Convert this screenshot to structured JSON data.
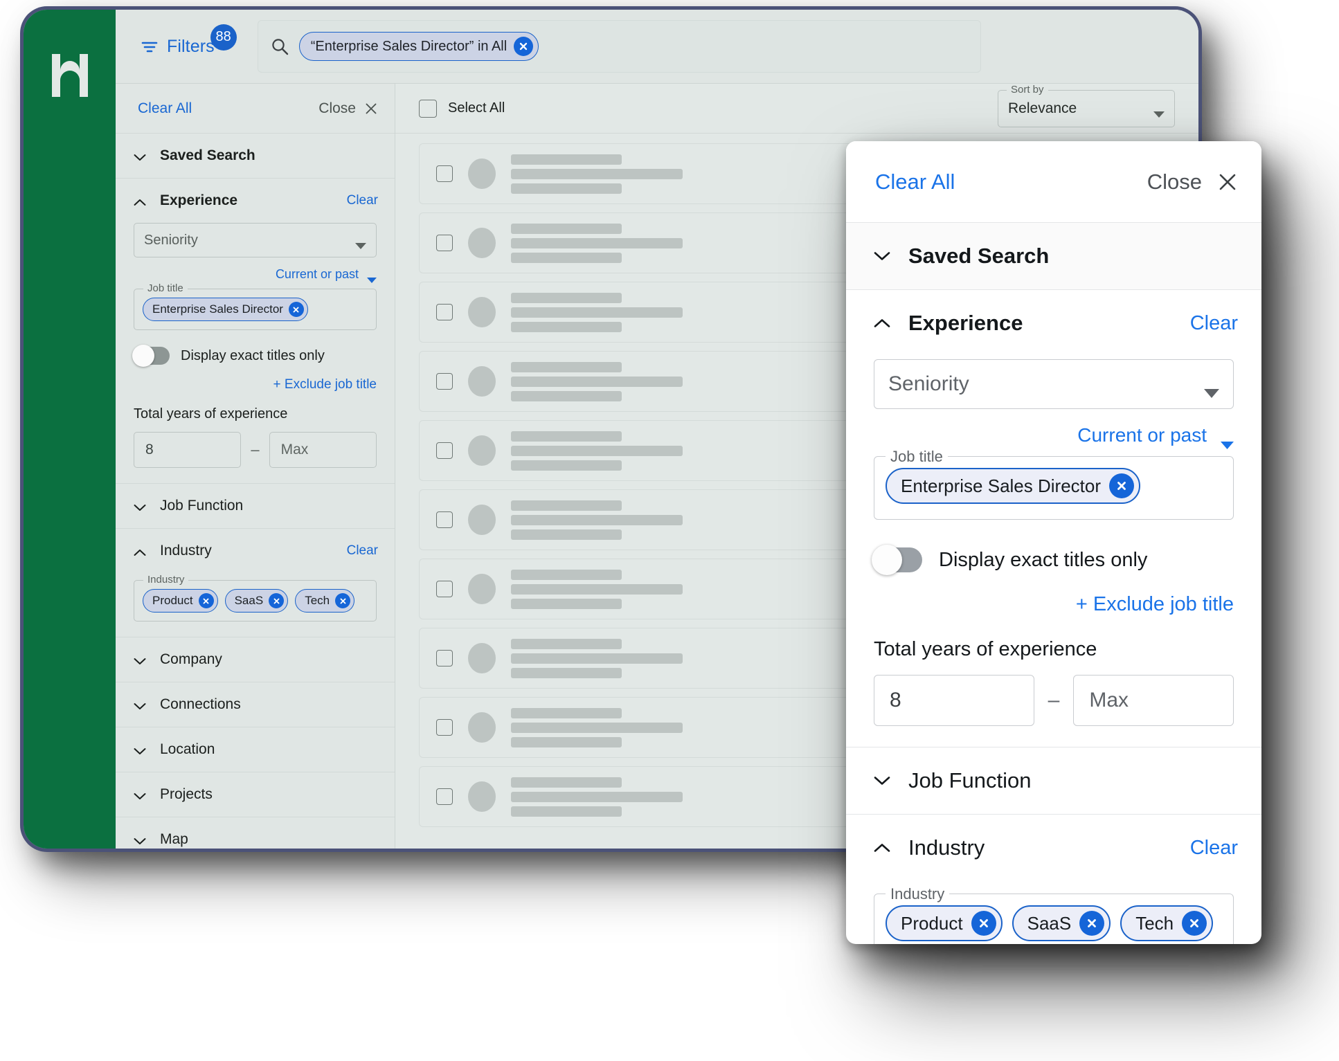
{
  "brand": {
    "logo_letter": "H",
    "logo_color": "#0b7040"
  },
  "accent": {
    "blue": "#1a73e8",
    "chip_blue": "#1565d8",
    "badge_blue": "#1a62c9"
  },
  "topbar": {
    "filters_label": "Filters",
    "filters_badge": "88",
    "filter_icon": "filter-lines-icon",
    "search_icon": "search-icon",
    "search_chip": "“Enterprise Sales Director” in All",
    "search_chip_remove_icon": "close-circle-icon"
  },
  "sidebar": {
    "clear_all": "Clear All",
    "close": "Close",
    "close_icon": "close-icon",
    "sections": [
      {
        "title": "Saved Search",
        "expanded": false,
        "clear": null
      },
      {
        "title": "Experience",
        "expanded": true,
        "clear": "Clear"
      },
      {
        "title": "Job Function",
        "expanded": false,
        "clear": null
      },
      {
        "title": "Industry",
        "expanded": true,
        "clear": "Clear"
      },
      {
        "title": "Company",
        "expanded": false,
        "clear": null
      },
      {
        "title": "Connections",
        "expanded": false,
        "clear": null
      },
      {
        "title": "Location",
        "expanded": false,
        "clear": null
      },
      {
        "title": "Projects",
        "expanded": false,
        "clear": null
      },
      {
        "title": "Map",
        "expanded": false,
        "clear": null
      }
    ],
    "experience": {
      "seniority_placeholder": "Seniority",
      "current_or_past": "Current or past",
      "job_title_legend": "Job title",
      "job_title_tags": [
        "Enterprise Sales Director"
      ],
      "exact_titles_toggle": "Display exact titles only",
      "exact_titles_on": false,
      "exclude_job_title": "+ Exclude job title",
      "years_label": "Total years of experience",
      "years_min": "8",
      "years_max_placeholder": "Max",
      "range_dash": "–"
    },
    "industry": {
      "legend": "Industry",
      "tags": [
        "Product",
        "SaaS",
        "Tech"
      ]
    }
  },
  "results": {
    "select_all": "Select All",
    "sort_legend": "Sort by",
    "sort_value": "Relevance",
    "rows": [
      {
        "line1": 160,
        "line2": 248,
        "line3": 160
      },
      {
        "line1": 160,
        "line2": 248,
        "line3": 160
      },
      {
        "line1": 160,
        "line2": 248,
        "line3": 160
      },
      {
        "line1": 160,
        "line2": 248,
        "line3": 160
      },
      {
        "line1": 160,
        "line2": 248,
        "line3": 160
      },
      {
        "line1": 160,
        "line2": 248,
        "line3": 160
      },
      {
        "line1": 160,
        "line2": 248,
        "line3": 160
      },
      {
        "line1": 160,
        "line2": 248,
        "line3": 160
      },
      {
        "line1": 160,
        "line2": 248,
        "line3": 160
      },
      {
        "line1": 160,
        "line2": 248,
        "line3": 160
      }
    ]
  },
  "card": {
    "clear_all": "Clear All",
    "close": "Close",
    "close_icon": "close-icon",
    "sections": {
      "saved_search": "Saved Search",
      "experience": "Experience",
      "experience_clear": "Clear",
      "job_function": "Job Function",
      "industry": "Industry",
      "industry_clear": "Clear"
    },
    "experience": {
      "seniority_placeholder": "Seniority",
      "current_or_past": "Current or past",
      "job_title_legend": "Job title",
      "job_title_tags": [
        "Enterprise Sales Director"
      ],
      "exact_titles_toggle": "Display exact titles only",
      "exact_titles_on": false,
      "exclude_job_title": "+ Exclude job title",
      "years_label": "Total years of experience",
      "years_min": "8",
      "years_max_placeholder": "Max",
      "range_dash": "–"
    },
    "industry": {
      "legend": "Industry",
      "tags": [
        "Product",
        "SaaS",
        "Tech"
      ]
    }
  }
}
